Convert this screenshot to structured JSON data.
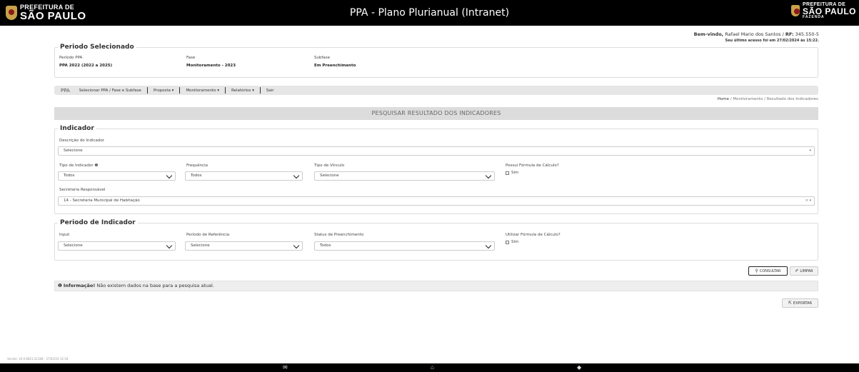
{
  "header": {
    "logo_left_line1": "PREFEITURA DE",
    "logo_left_line2": "SÃO PAULO",
    "app_title": "PPA - Plano Plurianual (Intranet)",
    "logo_right_line1": "PREFEITURA DE",
    "logo_right_line2": "SÃO PAULO",
    "logo_right_line3": "FAZENDA"
  },
  "user": {
    "welcome_prefix": "Bem-vindo,",
    "name": "Rafael Mario dos Santos / ",
    "rf_label": "RF:",
    "rf_value": " 345.550-5",
    "last_access": "Seu último acesso foi em 27/02/2024 às 15:22."
  },
  "periodo": {
    "legend": "Periodo Selecionado",
    "ppa_label": "Período PPA",
    "ppa_value": "PPA 2022 (2022 a 2025)",
    "fase_label": "Fase",
    "fase_value": "Monitoramento - 2023",
    "subfase_label": "Subfase",
    "subfase_value": "Em Preenchimento"
  },
  "nav": {
    "brand": "PPA",
    "items": [
      "Selecionar PPA / Fase e Subfase",
      "Proposta ▾",
      "Monitoramento ▾",
      "Relatórios ▾",
      "Sair"
    ]
  },
  "breadcrumb": {
    "home": "Home",
    "sep": " / ",
    "level1": "Monitoramento",
    "level2": "Resultado dos Indicadores"
  },
  "page_title": "PESQUISAR RESULTADO DOS INDICADORES",
  "indicador": {
    "legend": "Indicador",
    "descricao_label": "Descrição do Indicador",
    "descricao_value": "Selecione",
    "tipo_label": "Tipo de Indicador",
    "tipo_value": "Todos",
    "frequencia_label": "Frequência",
    "frequencia_value": "Todos",
    "vinculo_label": "Tipo de Vínculo",
    "vinculo_value": "Selecione",
    "formula_label": "Possui Fórmula de Cálculo?",
    "formula_option": "Sim",
    "secretaria_label": "Secretaria Responsável",
    "secretaria_value": "14 - Secretaria Municipal de Habitação"
  },
  "periodo_indicador": {
    "legend": "Periodo de Indicador",
    "input_label": "Input",
    "input_value": "Selecione",
    "referencia_label": "Período de Referência",
    "referencia_value": "Selecione",
    "status_label": "Status de Preenchimento",
    "status_value": "Todos",
    "utilizar_label": "Utilizar Fórmula de Cálculo?",
    "utilizar_option": "Sim"
  },
  "buttons": {
    "consultar": "CONSULTAR",
    "limpar": "LIMPAR",
    "exportar": "EXPORTAR"
  },
  "info": {
    "title": "Informação!",
    "message": " Não existem dados na base para a pesquisa atual."
  },
  "footer": {
    "version": "Versão: 10.0.8823.22188 - 27/02/24 12:18"
  }
}
